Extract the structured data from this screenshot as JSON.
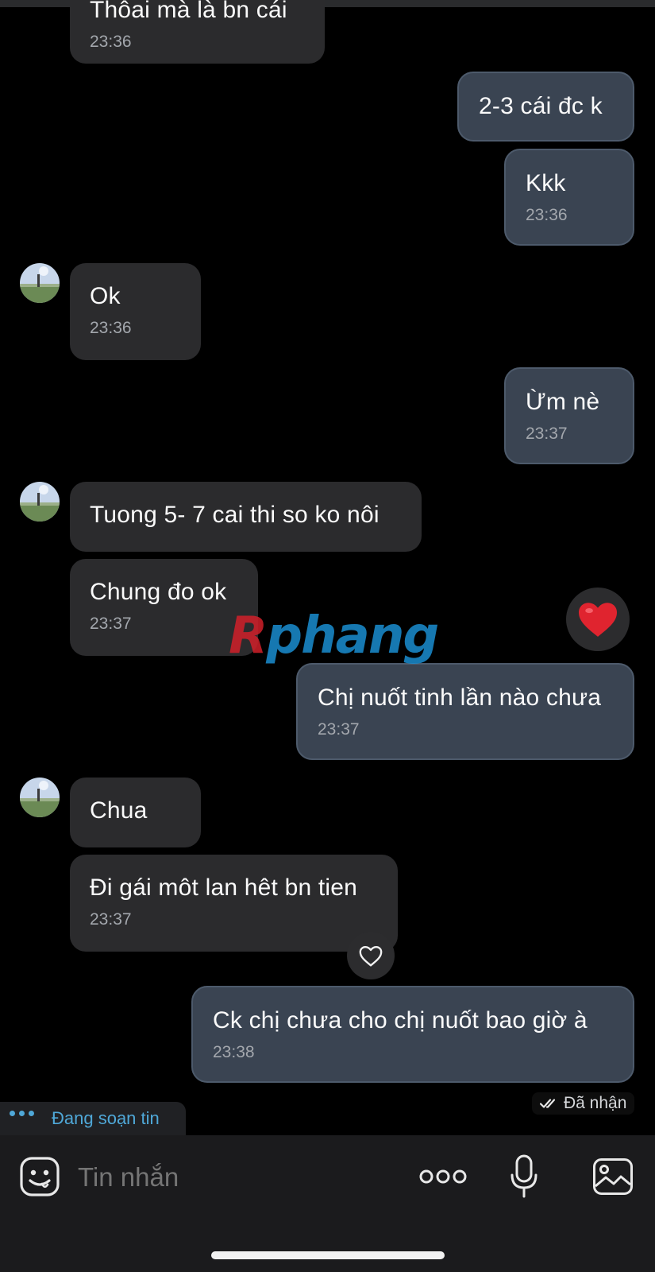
{
  "messages": [
    {
      "id": "m0",
      "dir": "in",
      "text": "Thôai mà là bn cái",
      "time": "23:36"
    },
    {
      "id": "m1",
      "dir": "out",
      "text": "2-3 cái đc k",
      "time": ""
    },
    {
      "id": "m2",
      "dir": "out",
      "text": "Kkk",
      "time": "23:36"
    },
    {
      "id": "m3",
      "dir": "in",
      "text": "Ok",
      "time": "23:36"
    },
    {
      "id": "m4",
      "dir": "out",
      "text": "Ừm nè",
      "time": "23:37"
    },
    {
      "id": "m5",
      "dir": "in",
      "text": "Tuong 5- 7 cai thi so ko nôi",
      "time": ""
    },
    {
      "id": "m6",
      "dir": "in",
      "text": "Chung đo ok",
      "time": "23:37"
    },
    {
      "id": "m7",
      "dir": "out",
      "text": "Chị nuốt tinh lần nào chưa",
      "time": "23:37"
    },
    {
      "id": "m8",
      "dir": "in",
      "text": "Chua",
      "time": ""
    },
    {
      "id": "m9",
      "dir": "in",
      "text": "Đi gái môt lan hêt bn tien",
      "time": "23:37"
    },
    {
      "id": "m10",
      "dir": "out",
      "text": "Ck chị chưa cho chị nuốt bao giờ à",
      "time": "23:38"
    }
  ],
  "reactions": {
    "heart_filled": {
      "icon": "heart-filled-icon",
      "color": "#e0242f"
    },
    "heart_outline": {
      "icon": "heart-outline-icon"
    }
  },
  "watermark": {
    "prefix": "R",
    "rest": "phang"
  },
  "delivery_status": {
    "icon": "double-check-icon",
    "label": "Đã nhận"
  },
  "typing_indicator": {
    "label": "Đang soạn tin"
  },
  "composer": {
    "placeholder": "Tin nhắn",
    "emoji_icon": "sticker-icon",
    "more_icon": "more-dots-icon",
    "mic_icon": "microphone-icon",
    "gallery_icon": "image-icon"
  },
  "colors": {
    "background": "#000000",
    "incoming_bubble": "#2b2b2d",
    "outgoing_bubble": "#3a4452",
    "accent": "#4fa8d8",
    "heart": "#e0242f"
  }
}
